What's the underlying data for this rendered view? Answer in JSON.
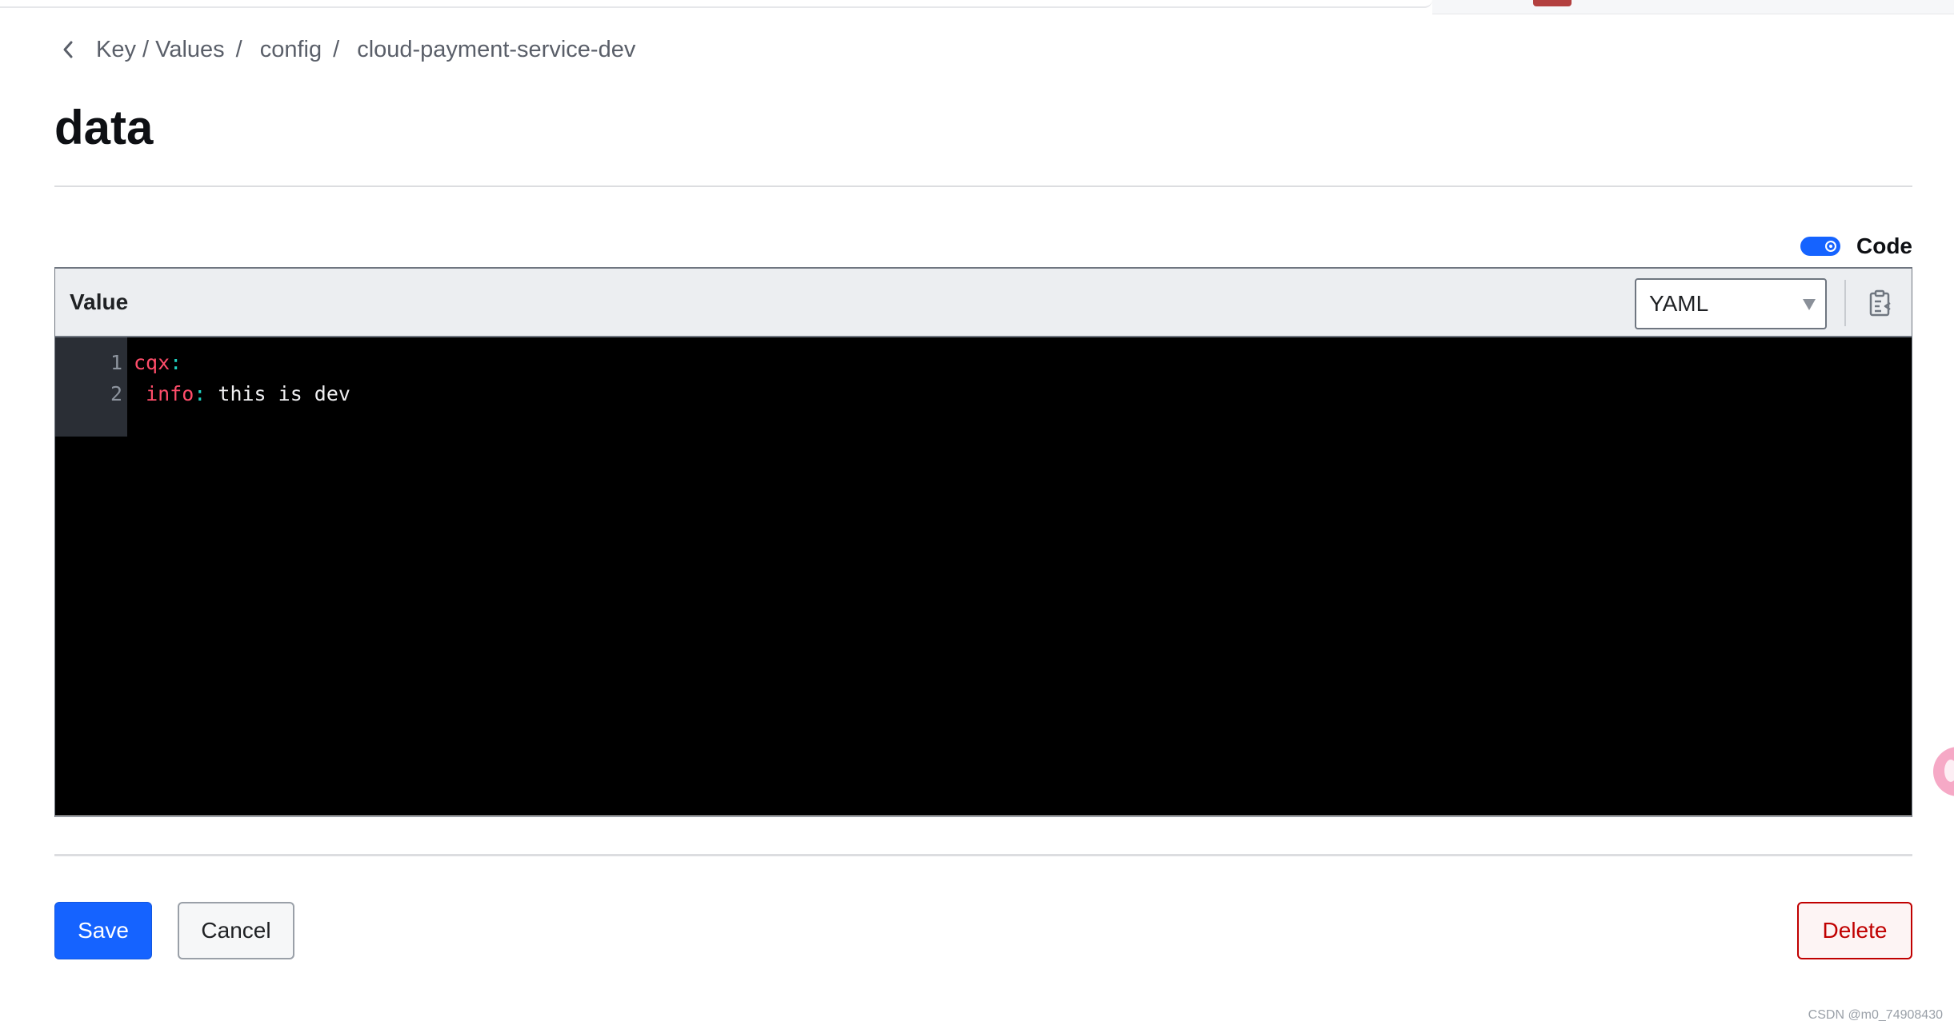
{
  "breadcrumb": {
    "items": [
      "Key / Values",
      "config"
    ],
    "current": "cloud-payment-service-dev",
    "separator": "/"
  },
  "page": {
    "title": "data"
  },
  "code_toggle": {
    "label": "Code",
    "enabled": true
  },
  "value_panel": {
    "label": "Value",
    "language": "YAML",
    "language_options": [
      "YAML"
    ]
  },
  "editor": {
    "lines": [
      {
        "number": "1",
        "indent": "",
        "key": "cqx",
        "colon": ":",
        "value": ""
      },
      {
        "number": "2",
        "indent": " ",
        "key": "info",
        "colon": ":",
        "value": " this is dev"
      }
    ]
  },
  "actions": {
    "save_label": "Save",
    "cancel_label": "Cancel",
    "delete_label": "Delete"
  },
  "watermark": "CSDN @m0_74908430",
  "colors": {
    "primary": "#1563ff",
    "danger": "#c00000",
    "editor_bg": "#000000",
    "yaml_key": "#ff4d6a",
    "yaml_colon": "#20d1c1"
  },
  "icons": {
    "back": "chevron-left-icon",
    "clipboard": "clipboard-icon",
    "caret": "caret-down-icon"
  }
}
